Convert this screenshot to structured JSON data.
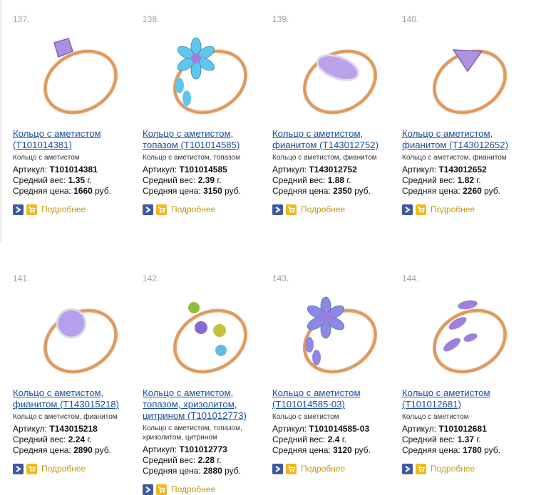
{
  "more_label": "Подробнее",
  "labels": {
    "article": "Артикул: ",
    "weight": "Средний вес: ",
    "price": "Средняя цена: ",
    "weight_unit": " г.",
    "price_unit": " руб."
  },
  "products": [
    {
      "num": "137.",
      "title": "Кольцо с аметистом (Т101014381)",
      "desc": "Кольцо с аметистом",
      "article": "Т101014381",
      "weight": "1.35",
      "price": "1660",
      "stone": "#a98fe0",
      "style": "solitaire"
    },
    {
      "num": "138.",
      "title": "Кольцо с аметистом, топазом (Т101014585)",
      "desc": "Кольцо с аметистом, топазом",
      "article": "Т101014585",
      "weight": "2.39",
      "price": "3150",
      "stone": "#5fc7ec",
      "style": "flower"
    },
    {
      "num": "139.",
      "title": "Кольцо с аметистом, фианитом (Т143012752)",
      "desc": "Кольцо с аметистом, фианитом",
      "article": "Т143012752",
      "weight": "1.88",
      "price": "2350",
      "stone": "#b9a2e6",
      "style": "marquise"
    },
    {
      "num": "140.",
      "title": "Кольцо с аметистом, фианитом (Т143012652)",
      "desc": "Кольцо с аметистом, фианитом",
      "article": "Т143012652",
      "weight": "1.82",
      "price": "2260",
      "stone": "#ae92e2",
      "style": "trillion"
    },
    {
      "num": "141.",
      "title": "Кольцо с аметистом, фианитом (Т143015218)",
      "desc": "Кольцо с аметистом, фианитом",
      "article": "Т143015218",
      "weight": "2.24",
      "price": "2890",
      "stone": "#b4a0ee",
      "style": "round"
    },
    {
      "num": "142.",
      "title": "Кольцо с аметистом, топазом, хризолитом, цитрином (Т101012773)",
      "desc": "Кольцо с аметистом, топазом, хризолитом, цитрином",
      "article": "Т101012773",
      "weight": "2.28",
      "price": "2880",
      "stone": "#9a7fd6",
      "style": "multi"
    },
    {
      "num": "143.",
      "title": "Кольцо с аметистом (Т101014585-03)",
      "desc": "Кольцо с аметистом",
      "article": "Т101014585-03",
      "weight": "2.4",
      "price": "3120",
      "stone": "#8f86e6",
      "style": "flower"
    },
    {
      "num": "144.",
      "title": "Кольцо с аметистом (Т101012681)",
      "desc": "Кольцо с аметистом",
      "article": "Т101012681",
      "weight": "1.37",
      "price": "1780",
      "stone": "#9d80dc",
      "style": "leaves"
    }
  ]
}
